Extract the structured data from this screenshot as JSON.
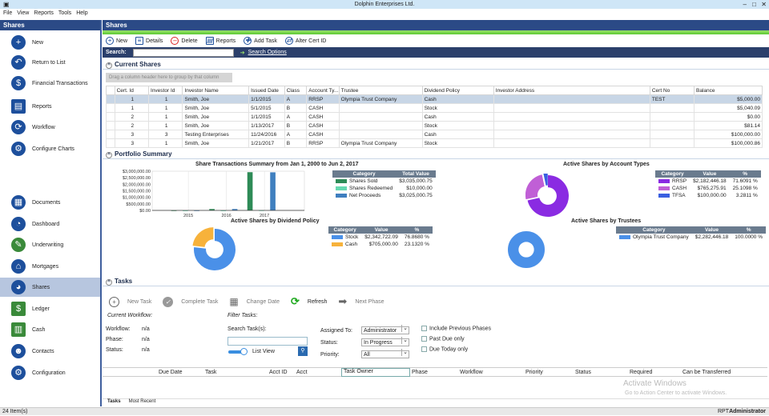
{
  "window": {
    "title": "Dolphin Enterprises Ltd."
  },
  "menu": [
    "File",
    "View",
    "Reports",
    "Tools",
    "Help"
  ],
  "sidebar": {
    "header": "Shares",
    "actions": [
      "New",
      "Return to List",
      "Financial Transactions",
      "Reports",
      "Workflow",
      "Configure Charts"
    ],
    "modules": [
      "Documents",
      "Dashboard",
      "Underwriting",
      "Mortgages",
      "Shares",
      "Ledger",
      "Cash",
      "Contacts",
      "Configuration"
    ]
  },
  "main": {
    "title": "Shares",
    "toolbar": [
      "New",
      "Details",
      "Delete",
      "Reports",
      "Add Task",
      "Alter Cert ID"
    ],
    "search": {
      "label": "Search:",
      "value": "",
      "options": "Search Options"
    },
    "current_shares": {
      "title": "Current Shares",
      "drag_hint": "Drag a column header here to group by that column",
      "columns": [
        "Cert. Id",
        "Investor Id",
        "Investor Name",
        "Issued Date",
        "Class",
        "Account Ty...",
        "Trustee",
        "Dividend Policy",
        "Investor Address",
        "Cert No",
        "Balance"
      ],
      "rows": [
        [
          "1",
          "1",
          "Smith, Joe",
          "1/1/2015",
          "A",
          "RRSP",
          "Olympia Trust Company",
          "Cash",
          "",
          "TEST",
          "$5,000.00"
        ],
        [
          "1",
          "1",
          "Smith, Joe",
          "5/1/2015",
          "B",
          "CASH",
          "",
          "Stock",
          "",
          "",
          "$5,040.09"
        ],
        [
          "2",
          "1",
          "Smith, Joe",
          "1/1/2015",
          "A",
          "CASH",
          "",
          "Cash",
          "",
          "",
          "$0.00"
        ],
        [
          "2",
          "1",
          "Smith, Joe",
          "1/13/2017",
          "B",
          "CASH",
          "",
          "Stock",
          "",
          "",
          "$81.14"
        ],
        [
          "3",
          "3",
          "Testing Enterprises",
          "11/24/2016",
          "A",
          "CASH",
          "",
          "Cash",
          "",
          "",
          "$100,000.00"
        ],
        [
          "3",
          "1",
          "Smith, Joe",
          "1/21/2017",
          "B",
          "RRSP",
          "Olympia Trust Company",
          "Stock",
          "",
          "",
          "$100,000.86"
        ]
      ]
    },
    "portfolio": {
      "title": "Portfolio Summary"
    },
    "tasks": {
      "title": "Tasks",
      "toolbar": [
        "New Task",
        "Complete Task",
        "Change Date",
        "Refresh",
        "Next Phase"
      ],
      "current_workflow": "Current Workflow:",
      "workflow_label": "Workflow:",
      "workflow": "n/a",
      "phase_label": "Phase:",
      "phase": "n/a",
      "status_label": "Status:",
      "status": "n/a",
      "filter_title": "Filter Tasks:",
      "search_label": "Search Task(s):",
      "list_view": "List View",
      "assigned_label": "Assigned To:",
      "assigned": "Administrator",
      "status_f_label": "Status:",
      "status_f": "In Progress",
      "priority_label": "Priority:",
      "priority": "All",
      "checks": [
        "Include Previous Phases",
        "Past Due only",
        "Due Today only"
      ],
      "columns": [
        "Due Date",
        "Task",
        "Acct ID",
        "Acct",
        "Task Owner",
        "Phase",
        "Workflow",
        "Priority",
        "Status",
        "Required",
        "Can be Transferred"
      ],
      "tabs": [
        "Tasks",
        "Most Recent"
      ]
    },
    "watermark": [
      "Activate Windows",
      "Go to Action Center to activate Windows."
    ]
  },
  "status": {
    "items": "24 Item(s)",
    "rpt": "RPT",
    "user": "Administrator"
  },
  "chart_data": [
    {
      "type": "bar",
      "title": "Share Transactions Summary from Jan 1, 2000 to Jun 2, 2017",
      "categories": [
        "2015",
        "2016",
        "2017"
      ],
      "yticks": [
        "$3,000,000.00",
        "$2,500,000.00",
        "$2,000,000.00",
        "$1,500,000.00",
        "$1,000,000.00",
        "$500,000.00",
        "$0.00"
      ],
      "ylim": [
        0,
        3000000
      ],
      "series": [
        {
          "name": "Shares Sold",
          "color": "#2e8b57",
          "values": [
            5000,
            105121,
            2925000
          ],
          "total": "$3,035,000.75"
        },
        {
          "name": "Shares Redeemed",
          "color": "#66d9b0",
          "values": [
            0,
            0,
            10000
          ],
          "total": "$10,000.00"
        },
        {
          "name": "Net Proceeds",
          "color": "#3f7fbf",
          "values": [
            5000,
            105121,
            2915000
          ],
          "total": "$3,025,000.75"
        }
      ],
      "legend_headers": [
        "Category",
        "Total Value"
      ]
    },
    {
      "type": "pie",
      "title": "Active Shares by Account Types",
      "legend_headers": [
        "Category",
        "Value",
        "%"
      ],
      "slices": [
        {
          "name": "RRSP",
          "value": "$2,182,446.18",
          "pct": "71.6091 %",
          "p": 71.6091,
          "color": "#8a2be2"
        },
        {
          "name": "CASH",
          "value": "$765,275.91",
          "pct": "25.1098 %",
          "p": 25.1098,
          "color": "#c05fd6"
        },
        {
          "name": "TFSA",
          "value": "$100,000.00",
          "pct": "3.2811 %",
          "p": 3.2811,
          "color": "#3a5fe0"
        }
      ]
    },
    {
      "type": "pie",
      "title": "Active Shares by Dividend Policy",
      "legend_headers": [
        "Category",
        "Value",
        "%"
      ],
      "slices": [
        {
          "name": "Stock",
          "value": "$2,342,722.09",
          "pct": "76.8680 %",
          "p": 76.868,
          "color": "#4a90e8"
        },
        {
          "name": "Cash",
          "value": "$705,000.00",
          "pct": "23.1320 %",
          "p": 23.132,
          "color": "#f7b23b"
        }
      ]
    },
    {
      "type": "pie",
      "title": "Active Shares by Trustees",
      "legend_headers": [
        "Category",
        "Value",
        "%"
      ],
      "slices": [
        {
          "name": "Olympia Trust Company",
          "value": "$2,282,446.18",
          "pct": "100.0000 %",
          "p": 100,
          "color": "#4a90e8"
        }
      ]
    }
  ]
}
